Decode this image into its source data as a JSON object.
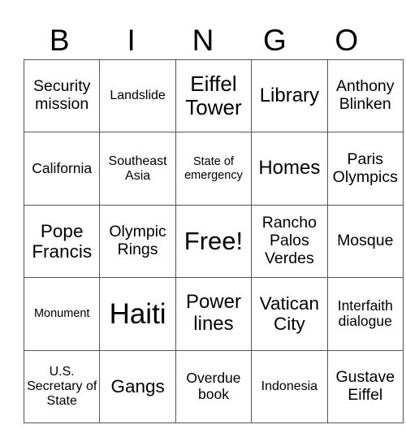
{
  "header": {
    "letters": [
      "B",
      "I",
      "N",
      "G",
      "O"
    ]
  },
  "card": {
    "rows": [
      [
        "Security mission",
        "Landslide",
        "Eiffel Tower",
        "Library",
        "Anthony Blinken"
      ],
      [
        "California",
        "Southeast Asia",
        "State of emergency",
        "Homes",
        "Paris Olympics"
      ],
      [
        "Pope Francis",
        "Olympic Rings",
        "Free!",
        "Rancho Palos Verdes",
        "Mosque"
      ],
      [
        "Monument",
        "Haiti",
        "Power lines",
        "Vatican City",
        "Interfaith dialogue"
      ],
      [
        "U.S. Secretary of State",
        "Gangs",
        "Overdue book",
        "Indonesia",
        "Gustave Eiffel"
      ]
    ]
  }
}
